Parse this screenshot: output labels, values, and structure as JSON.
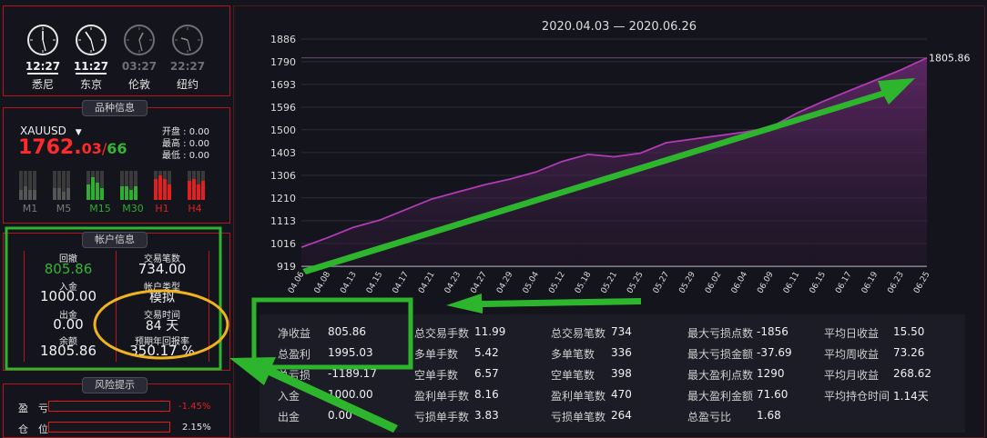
{
  "clocks": [
    {
      "time": "12:27",
      "city": "悉尼",
      "active": true
    },
    {
      "time": "11:27",
      "city": "东京",
      "active": true
    },
    {
      "time": "03:27",
      "city": "伦敦",
      "active": false
    },
    {
      "time": "22:27",
      "city": "纽约",
      "active": false
    }
  ],
  "instrument_section": {
    "tab": "品种信息",
    "symbol": "XAUUSD",
    "price_main": "1762.",
    "price_frac": "03",
    "price_sep": "/",
    "price_alt": "66",
    "ohlc": [
      {
        "label": "开盘",
        "value": "0.00"
      },
      {
        "label": "最高",
        "value": "0.00"
      },
      {
        "label": "最低",
        "value": "0.00"
      }
    ],
    "timeframes": [
      {
        "label": "M1",
        "color": "#7a7a7a"
      },
      {
        "label": "M5",
        "color": "#7a7a7a"
      },
      {
        "label": "M15",
        "color": "#2eae2e"
      },
      {
        "label": "M30",
        "color": "#2eae2e"
      },
      {
        "label": "H1",
        "color": "#e02020"
      },
      {
        "label": "H4",
        "color": "#e02020"
      }
    ]
  },
  "account_section": {
    "tab": "帐户信息",
    "items": [
      {
        "label": "回撤",
        "value": "805.86",
        "value_color": "#35b535"
      },
      {
        "label": "交易笔数",
        "value": "734.00"
      },
      {
        "label": "入金",
        "value": "1000.00"
      },
      {
        "label": "帐户类型",
        "value": "模拟"
      },
      {
        "label": "出金",
        "value": "0.00"
      },
      {
        "label": "交易时间",
        "value": "84 天"
      },
      {
        "label": "余额",
        "value": "1805.86"
      },
      {
        "label": "预期年回报率",
        "value": "350.17 %"
      }
    ]
  },
  "risk_section": {
    "tab": "风险提示",
    "rows": [
      {
        "label": "盈　亏",
        "value": "-1.45%",
        "value_color": "#e02020"
      },
      {
        "label": "仓　位",
        "value": "2.15%",
        "value_color": "#e6e6e6"
      }
    ]
  },
  "chart_data": {
    "type": "area",
    "title": "2020.04.03 — 2020.06.26",
    "y_ticks": [
      "1886",
      "1790",
      "1693",
      "1596",
      "1500",
      "1403",
      "1306",
      "1210",
      "1113",
      "1016",
      "919"
    ],
    "ylim": [
      919,
      1886
    ],
    "x_ticks": [
      "04.06",
      "04.08",
      "04.13",
      "04.15",
      "04.17",
      "04.21",
      "04.23",
      "04.27",
      "04.29",
      "05.04",
      "05.12",
      "05.18",
      "05.21",
      "05.25",
      "05.27",
      "05.29",
      "06.02",
      "06.04",
      "06.09",
      "06.11",
      "06.15",
      "06.17",
      "06.19",
      "06.23",
      "06.25"
    ],
    "end_label": "1805.86",
    "series": [
      {
        "color": "#b13bb5",
        "x": [
          0,
          1,
          2,
          3,
          4,
          5,
          6,
          7,
          8,
          9,
          10,
          11,
          12,
          13,
          14,
          15,
          16,
          17,
          18,
          19,
          20,
          21,
          22,
          23,
          24
        ],
        "y": [
          1000,
          1040,
          1085,
          1115,
          1160,
          1205,
          1235,
          1265,
          1290,
          1320,
          1365,
          1395,
          1385,
          1400,
          1445,
          1460,
          1475,
          1490,
          1510,
          1570,
          1620,
          1665,
          1710,
          1755,
          1805.86
        ]
      }
    ]
  },
  "stats": {
    "columns": [
      [
        {
          "label": "净收益",
          "value": "805.86"
        },
        {
          "label": "总盈利",
          "value": "1995.03"
        },
        {
          "label": "总亏损",
          "value": "-1189.17"
        },
        {
          "label": "入金",
          "value": "1000.00"
        },
        {
          "label": "出金",
          "value": "0.00"
        }
      ],
      [
        {
          "label": "总交易手数",
          "value": "11.99"
        },
        {
          "label": "多单手数",
          "value": "5.42"
        },
        {
          "label": "空单手数",
          "value": "6.57"
        },
        {
          "label": "盈利单手数",
          "value": "8.16"
        },
        {
          "label": "亏损单手数",
          "value": "3.83"
        }
      ],
      [
        {
          "label": "总交易笔数",
          "value": "734"
        },
        {
          "label": "多单笔数",
          "value": "336"
        },
        {
          "label": "空单笔数",
          "value": "398"
        },
        {
          "label": "盈利单笔数",
          "value": "470"
        },
        {
          "label": "亏损单笔数",
          "value": "264"
        }
      ],
      [
        {
          "label": "最大亏损点数",
          "value": "-1856"
        },
        {
          "label": "最大亏损金额",
          "value": "-37.69"
        },
        {
          "label": "最大盈利点数",
          "value": "1290"
        },
        {
          "label": "最大盈利金额",
          "value": "71.60"
        },
        {
          "label": "总盈亏比",
          "value": "1.68"
        }
      ],
      [
        {
          "label": "平均日收益",
          "value": "15.50"
        },
        {
          "label": "平均周收益",
          "value": "73.26"
        },
        {
          "label": "平均月收益",
          "value": "268.62"
        },
        {
          "label": "平均持仓时间",
          "value": "1.14天"
        }
      ]
    ]
  },
  "annotations": {
    "highlight_color": "#2db52d",
    "ellipse_color": "#f0b21e"
  }
}
